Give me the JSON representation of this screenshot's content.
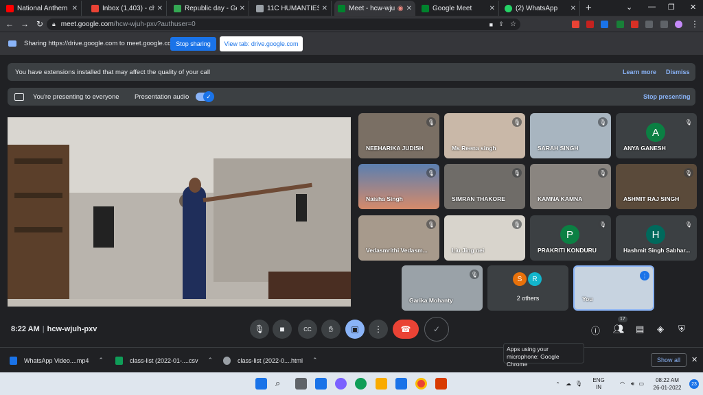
{
  "tabs": [
    {
      "title": "National Anthem of In",
      "color": "#ff0000"
    },
    {
      "title": "Inbox (1,403) - charlo",
      "color": "#ea4335"
    },
    {
      "title": "Republic day - Go",
      "color": "#34a853"
    },
    {
      "title": "11C HUMANTIES 202",
      "color": "#9aa0a6"
    },
    {
      "title": "Meet - hcw-wjuh-",
      "color": "#00832d",
      "active": true
    },
    {
      "title": "Google Meet",
      "color": "#00832d"
    },
    {
      "title": "(2) WhatsApp",
      "color": "#25d366"
    }
  ],
  "address": {
    "host": "meet.google.com",
    "path": "/hcw-wjuh-pxv?authuser=0"
  },
  "sharing": {
    "text": "Sharing https://drive.google.com to meet.google.com",
    "stop_label": "Stop sharing",
    "view_label": "View tab: drive.google.com"
  },
  "ext_banner": {
    "text": "You have extensions installed that may affect the quality of your call",
    "learn": "Learn more",
    "dismiss": "Dismiss"
  },
  "present_banner": {
    "text": "You're presenting to everyone",
    "audio": "Presentation audio",
    "stop": "Stop presenting"
  },
  "participants": [
    {
      "name": "NEEHARIKA JUDISH",
      "bg": "#7a6f64"
    },
    {
      "name": "Ms Reena singh",
      "bg": "#c9b8a8"
    },
    {
      "name": "SARAH SINGH",
      "bg": "#a8b5c0"
    },
    {
      "name": "ANYA GANESH",
      "initial": "A",
      "color": "#0b8043"
    },
    {
      "name": "Naisha Singh",
      "bg": "#d58a6a"
    },
    {
      "name": "SIMRAN THAKORE",
      "bg": "#6f6c68"
    },
    {
      "name": "KAMNA KAMNA",
      "bg": "#8a8580"
    },
    {
      "name": "ASHMIT RAJ SINGH",
      "bg": "#5a4a3a"
    },
    {
      "name": "Vedasmrithi Vedasm...",
      "bg": "#a79a8c"
    },
    {
      "name": "Liu Jing nei",
      "bg": "#d8d4cc"
    },
    {
      "name": "PRAKRITI KONDURU",
      "initial": "P",
      "color": "#0b8043"
    },
    {
      "name": "Hashmit Singh Sabhar...",
      "initial": "H",
      "color": "#00695c"
    },
    {
      "name": "Garika Mohanty",
      "bg": "#9aa2a8"
    }
  ],
  "others": {
    "label": "2 others",
    "avatars": [
      {
        "initial": "S",
        "color": "#e8710a"
      },
      {
        "initial": "R",
        "color": "#12b5cb"
      }
    ]
  },
  "self": {
    "name": "You"
  },
  "meeting": {
    "time": "8:22 AM",
    "code": "hcw-wjuh-pxv",
    "participant_count": "17"
  },
  "tooltip": {
    "text": "Apps using your microphone: Google Chrome"
  },
  "downloads": [
    {
      "name": "WhatsApp Video....mp4",
      "color": "#1a73e8"
    },
    {
      "name": "class-list (2022-01-....csv",
      "color": "#0f9d58"
    },
    {
      "name": "class-list (2022-0....html",
      "color": "#9aa0a6"
    }
  ],
  "show_all": "Show all",
  "system": {
    "lang": "ENG",
    "region": "IN",
    "time": "08:22 AM",
    "date": "26-01-2022",
    "notifications": "23"
  }
}
